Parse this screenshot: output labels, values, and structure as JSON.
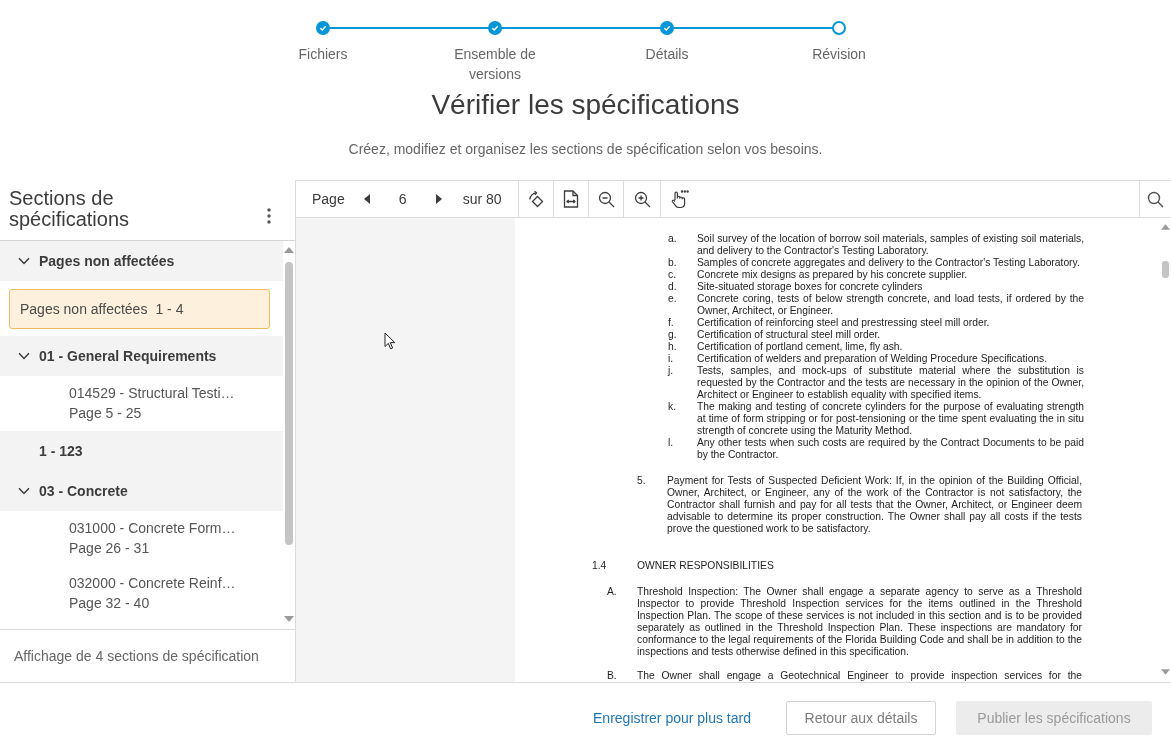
{
  "steps": [
    {
      "label": "Fichiers",
      "completed": true
    },
    {
      "label": "Ensemble de versions",
      "completed": true
    },
    {
      "label": "Détails",
      "completed": true
    },
    {
      "label": "Révision",
      "completed": false
    }
  ],
  "page": {
    "title": "Vérifier les spécifications",
    "subtitle": "Créez, modifiez et organisez les sections de spécification selon vos besoins."
  },
  "sidebar": {
    "title": "Sections de spécifications",
    "tree": [
      {
        "kind": "group",
        "label": "Pages non affectées",
        "expanded": true,
        "children": [
          {
            "kind": "range",
            "label": "Pages non affectées",
            "pages": "1 - 4",
            "selected": true
          }
        ]
      },
      {
        "kind": "group",
        "label": "01 - General Requirements",
        "expanded": true,
        "children": [
          {
            "kind": "section",
            "label": "014529 - Structural Testi…",
            "pages": "Page 5 - 25",
            "selected": false
          }
        ]
      },
      {
        "kind": "heading",
        "label": "1 - 123"
      },
      {
        "kind": "group",
        "label": "03 - Concrete",
        "expanded": true,
        "children": [
          {
            "kind": "section",
            "label": "031000 - Concrete Form…",
            "pages": "Page 26 - 31",
            "selected": false
          },
          {
            "kind": "section",
            "label": "032000 - Concrete Reinf…",
            "pages": "Page 32 - 40",
            "selected": false
          }
        ]
      }
    ],
    "footer": "Affichage de 4 sections de spécification"
  },
  "viewer": {
    "toolbar": {
      "page_label": "Page",
      "page": "6",
      "total": "sur 80"
    },
    "document": {
      "lettered_items": [
        {
          "marker": "a.",
          "text": "Soil survey of the location of borrow soil materials, samples of existing soil materials, and delivery to the Contractor's Testing Laboratory."
        },
        {
          "marker": "b.",
          "text": "Samples of concrete aggregates and delivery to the Contractor's Testing Laboratory."
        },
        {
          "marker": "c.",
          "text": "Concrete mix designs as prepared by his concrete supplier."
        },
        {
          "marker": "d.",
          "text": "Site-situated storage boxes for concrete cylinders"
        },
        {
          "marker": "e.",
          "text": "Concrete coring, tests of below strength concrete, and load tests, if ordered by the Owner, Architect, or Engineer."
        },
        {
          "marker": "f.",
          "text": "Certification of reinforcing steel and prestressing steel mill order."
        },
        {
          "marker": "g.",
          "text": "Certification of structural steel mill order."
        },
        {
          "marker": "h.",
          "text": "Certification of portland cement, lime, fly ash."
        },
        {
          "marker": "i.",
          "text": "Certification of welders and preparation of Welding Procedure Specifications."
        },
        {
          "marker": "j.",
          "text": "Tests, samples, and mock-ups of substitute material where the substitution is requested by the Contractor and the tests are necessary in the opinion of the Owner, Architect or Engineer to establish equality with specified items."
        },
        {
          "marker": "k.",
          "text": "The making and testing of concrete cylinders for the purpose of evaluating strength at time of form stripping or for post-tensioning or the time spent evaluating the in situ strength of concrete using the Maturity Method."
        },
        {
          "marker": "l.",
          "text": "Any other tests when such costs are required by the Contract Documents to be paid by the Contractor."
        }
      ],
      "numbered_items": [
        {
          "marker": "5.",
          "text": "Payment for Tests of Suspected Deficient Work: If, in the opinion of the Building Official, Owner, Architect, or Engineer, any of the work of the Contractor is not satisfactory, the Contractor shall furnish and pay for all tests that the Owner, Architect, or Engineer deem advisable to determine its proper construction. The Owner shall pay all costs if the tests prove the questioned work to be satisfactory."
        }
      ],
      "article": {
        "number": "1.4",
        "heading": "OWNER RESPONSIBILITIES"
      },
      "paragraphs": [
        {
          "marker": "A.",
          "text": "Threshold Inspection: The Owner shall engage a separate agency to serve as a Threshold Inspector to provide Threshold Inspection services for the items outlined in the Threshold Inspection Plan. The scope of these services is not included in this section and is to be provided separately as outlined in the Threshold Inspection Plan. These inspections are mandatory for conformance to the legal requirements of the Florida Building Code and shall be in addition to the inspections and tests otherwise defined in this specification.",
          "cut_off": false
        },
        {
          "marker": "B.",
          "text": "The Owner shall engage a Geotechnical Engineer to provide inspection services for the",
          "cut_off": true
        }
      ]
    }
  },
  "actions": [
    {
      "kind": "link",
      "label": "Enregistrer pour plus tard",
      "disabled": false
    },
    {
      "kind": "secondary",
      "label": "Retour aux détails",
      "disabled": false
    },
    {
      "kind": "primary",
      "label": "Publier les spécifications",
      "disabled": true
    }
  ]
}
